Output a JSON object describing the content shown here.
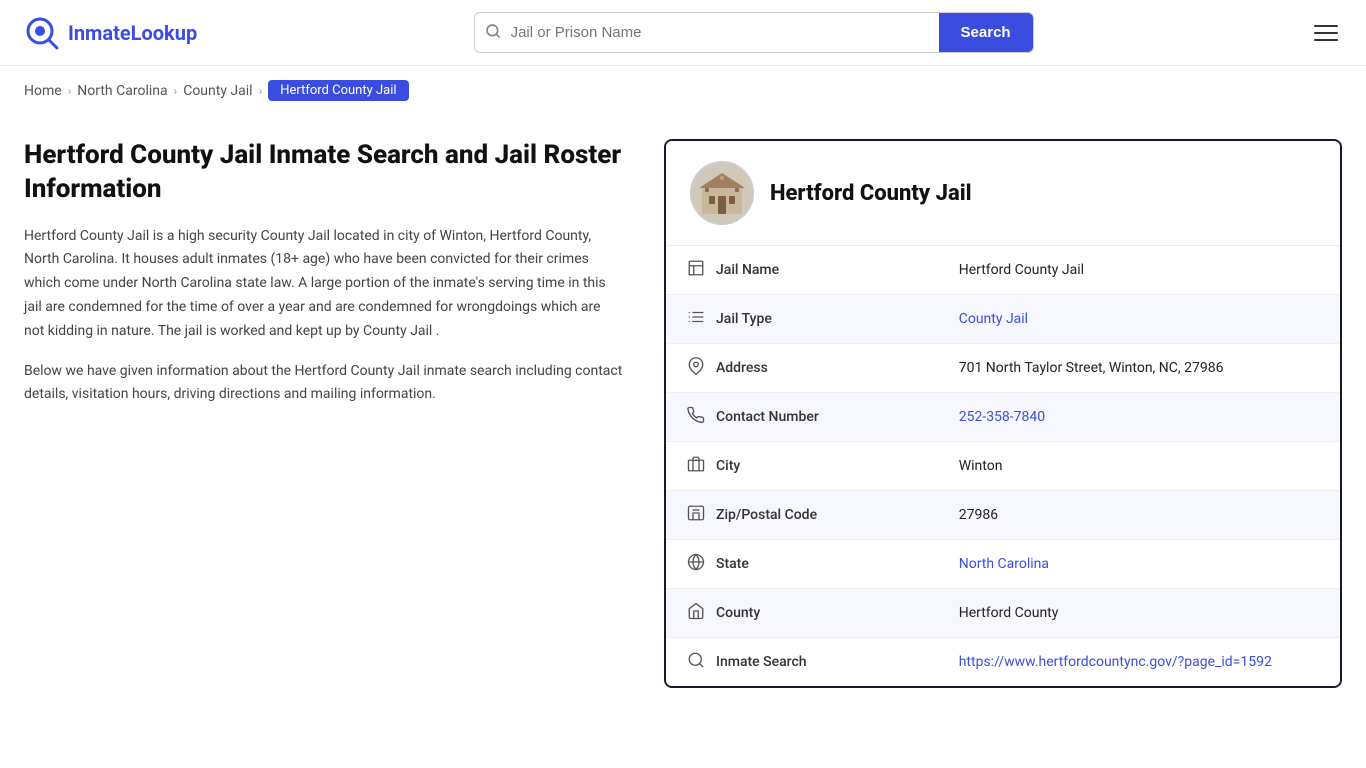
{
  "header": {
    "logo_text_prefix": "Inmate",
    "logo_text_suffix": "Lookup",
    "search_placeholder": "Jail or Prison Name",
    "search_button_label": "Search"
  },
  "breadcrumb": {
    "home": "Home",
    "state": "North Carolina",
    "type": "County Jail",
    "current": "Hertford County Jail"
  },
  "left": {
    "heading": "Hertford County Jail Inmate Search and Jail Roster Information",
    "desc1": "Hertford County Jail is a high security County Jail located in city of Winton, Hertford County, North Carolina. It houses adult inmates (18+ age) who have been convicted for their crimes which come under North Carolina state law. A large portion of the inmate's serving time in this jail are condemned for the time of over a year and are condemned for wrongdoings which are not kidding in nature. The jail is worked and kept up by County Jail .",
    "desc2": "Below we have given information about the Hertford County Jail inmate search including contact details, visitation hours, driving directions and mailing information."
  },
  "card": {
    "title": "Hertford County Jail",
    "rows": [
      {
        "icon": "jail-icon",
        "label": "Jail Name",
        "value": "Hertford County Jail",
        "link": null
      },
      {
        "icon": "type-icon",
        "label": "Jail Type",
        "value": "County Jail",
        "link": "#"
      },
      {
        "icon": "location-icon",
        "label": "Address",
        "value": "701 North Taylor Street, Winton, NC, 27986",
        "link": null
      },
      {
        "icon": "phone-icon",
        "label": "Contact Number",
        "value": "252-358-7840",
        "link": "tel:252-358-7840"
      },
      {
        "icon": "city-icon",
        "label": "City",
        "value": "Winton",
        "link": null
      },
      {
        "icon": "zip-icon",
        "label": "Zip/Postal Code",
        "value": "27986",
        "link": null
      },
      {
        "icon": "state-icon",
        "label": "State",
        "value": "North Carolina",
        "link": "#"
      },
      {
        "icon": "county-icon",
        "label": "County",
        "value": "Hertford County",
        "link": null
      },
      {
        "icon": "search-icon",
        "label": "Inmate Search",
        "value": "https://www.hertfordcountync.gov/?page_id=1592",
        "link": "https://www.hertfordcountync.gov/?page_id=1592"
      }
    ]
  }
}
